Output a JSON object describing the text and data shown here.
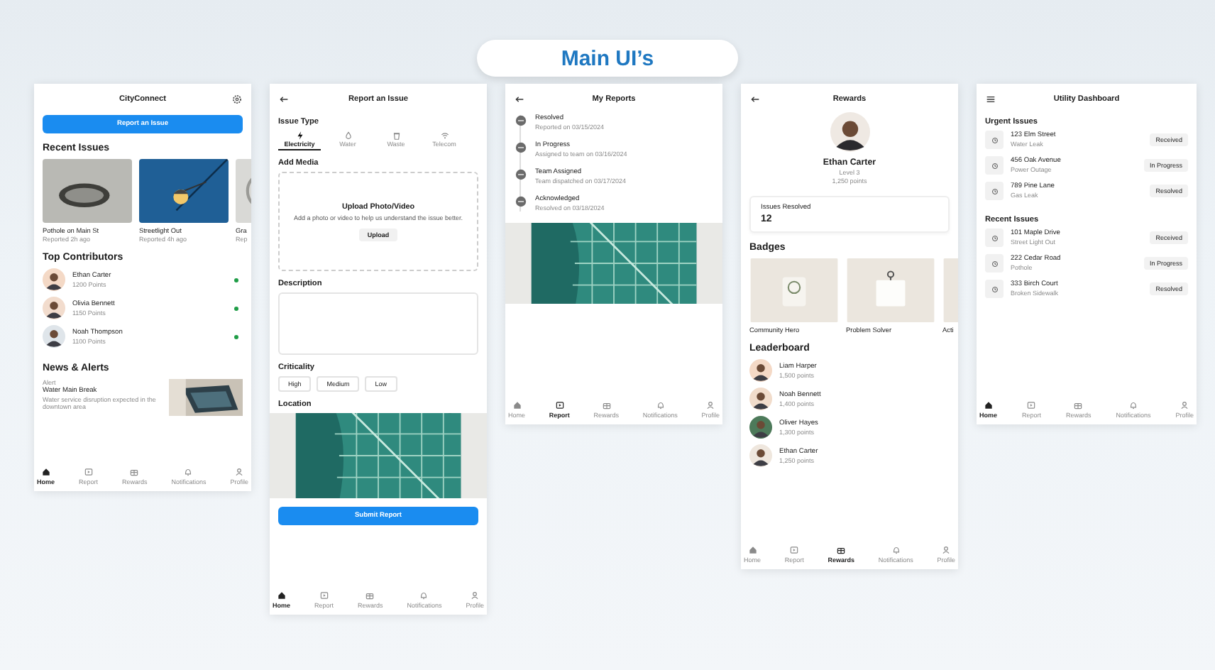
{
  "title": "Main UI’s",
  "home": {
    "app_title": "CityConnect",
    "report_button": "Report an Issue",
    "recent_heading": "Recent Issues",
    "recent_issues": [
      {
        "title": "Pothole on Main St",
        "time": "Reported 2h ago"
      },
      {
        "title": "Streetlight Out",
        "time": "Reported 4h ago"
      },
      {
        "title": "Gra",
        "time": "Rep"
      }
    ],
    "contributors_heading": "Top Contributors",
    "contributors": [
      {
        "name": "Ethan Carter",
        "points": "1200 Points",
        "online": true
      },
      {
        "name": "Olivia Bennett",
        "points": "1150 Points",
        "online": true
      },
      {
        "name": "Noah Thompson",
        "points": "1100 Points",
        "online": true
      }
    ],
    "news_heading": "News & Alerts",
    "news": {
      "tag": "Alert",
      "title": "Water Main Break",
      "text": "Water service disruption expected in the downtown area"
    },
    "nav": [
      {
        "label": "Home",
        "selected": true
      },
      {
        "label": "Report",
        "selected": false
      },
      {
        "label": "Rewards",
        "selected": false
      },
      {
        "label": "Notifications",
        "selected": false
      },
      {
        "label": "Profile",
        "selected": false
      }
    ]
  },
  "report": {
    "title": "Report an Issue",
    "issue_type_heading": "Issue Type",
    "issue_types": [
      {
        "label": "Electricity",
        "selected": true
      },
      {
        "label": "Water",
        "selected": false
      },
      {
        "label": "Waste",
        "selected": false
      },
      {
        "label": "Telecom",
        "selected": false
      }
    ],
    "media_heading": "Add Media",
    "upload_title": "Upload Photo/Video",
    "upload_text": "Add a photo or video to help us understand the issue better.",
    "upload_button": "Upload",
    "description_heading": "Description",
    "criticality_heading": "Criticality",
    "criticality": [
      {
        "label": "High",
        "selected": false
      },
      {
        "label": "Medium",
        "selected": false
      },
      {
        "label": "Low",
        "selected": false
      }
    ],
    "location_heading": "Location",
    "submit_button": "Submit Report",
    "nav": [
      {
        "label": "Home",
        "selected": true
      },
      {
        "label": "Report",
        "selected": false
      },
      {
        "label": "Rewards",
        "selected": false
      },
      {
        "label": "Notifications",
        "selected": false
      },
      {
        "label": "Profile",
        "selected": false
      }
    ]
  },
  "my_reports": {
    "title": "My Reports",
    "timeline": [
      {
        "status": "Resolved",
        "detail": "Reported on 03/15/2024"
      },
      {
        "status": "In Progress",
        "detail": "Assigned to team on 03/16/2024"
      },
      {
        "status": "Team Assigned",
        "detail": "Team dispatched on 03/17/2024"
      },
      {
        "status": "Acknowledged",
        "detail": "Resolved on 03/18/2024"
      }
    ],
    "nav": [
      {
        "label": "Home",
        "selected": false
      },
      {
        "label": "Report",
        "selected": true
      },
      {
        "label": "Rewards",
        "selected": false
      },
      {
        "label": "Notifications",
        "selected": false
      },
      {
        "label": "Profile",
        "selected": false
      }
    ]
  },
  "rewards": {
    "title": "Rewards",
    "name": "Ethan Carter",
    "level": "Level 3",
    "points": "1,250 points",
    "stat_label": "Issues Resolved",
    "stat_value": "12",
    "badges_heading": "Badges",
    "badges": [
      {
        "label": "Community Hero"
      },
      {
        "label": "Problem Solver"
      },
      {
        "label": "Acti"
      }
    ],
    "leaderboard_heading": "Leaderboard",
    "leaderboard": [
      {
        "name": "Liam Harper",
        "points": "1,500 points"
      },
      {
        "name": "Noah Bennett",
        "points": "1,400 points"
      },
      {
        "name": "Oliver Hayes",
        "points": "1,300 points"
      },
      {
        "name": "Ethan Carter",
        "points": "1,250 points"
      }
    ],
    "nav": [
      {
        "label": "Home",
        "selected": false
      },
      {
        "label": "Report",
        "selected": false
      },
      {
        "label": "Rewards",
        "selected": true
      },
      {
        "label": "Notifications",
        "selected": false
      },
      {
        "label": "Profile",
        "selected": false
      }
    ]
  },
  "dashboard": {
    "title": "Utility Dashboard",
    "sections": [
      {
        "heading": "Urgent Issues",
        "items": [
          {
            "address": "123 Elm Street",
            "issue": "Water Leak",
            "status": "Received"
          },
          {
            "address": "456 Oak Avenue",
            "issue": "Power Outage",
            "status": "In Progress"
          },
          {
            "address": "789 Pine Lane",
            "issue": "Gas Leak",
            "status": "Resolved"
          }
        ]
      },
      {
        "heading": "Recent Issues",
        "items": [
          {
            "address": "101 Maple Drive",
            "issue": "Street Light Out",
            "status": "Received"
          },
          {
            "address": "222 Cedar Road",
            "issue": "Pothole",
            "status": "In Progress"
          },
          {
            "address": "333 Birch Court",
            "issue": "Broken Sidewalk",
            "status": "Resolved"
          }
        ]
      }
    ],
    "nav": [
      {
        "label": "Home",
        "selected": true
      },
      {
        "label": "Report",
        "selected": false
      },
      {
        "label": "Rewards",
        "selected": false
      },
      {
        "label": "Notifications",
        "selected": false
      },
      {
        "label": "Profile",
        "selected": false
      }
    ]
  }
}
